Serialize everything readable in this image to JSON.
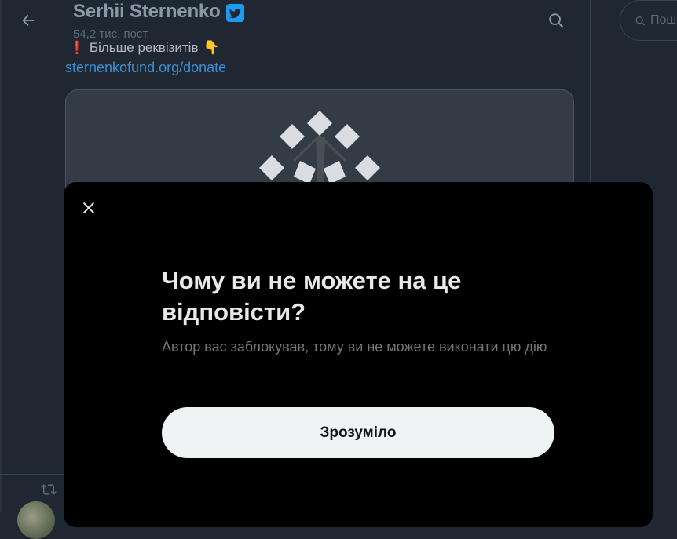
{
  "header": {
    "name": "Serhii Sternenko",
    "post_count": "54,2 тис. пост",
    "verified_icon": "verified-badge-icon",
    "back_icon": "arrow-left-icon",
    "search_icon": "search-icon"
  },
  "search": {
    "placeholder": "Пош"
  },
  "tweet": {
    "text_line": "Більше реквізитів",
    "link": "sternenkofund.org/donate"
  },
  "modal": {
    "title": "Чому ви не можете на це відповісти?",
    "description": "Автор вас заблокував, тому ви не можете виконати цю дію",
    "button_label": "Зрозуміло",
    "close_icon": "close-icon"
  },
  "colors": {
    "background": "#1f2732",
    "modal_bg": "#000000",
    "accent": "#1d9bf0",
    "link": "#3e8fd1",
    "button_bg": "#eff3f4"
  }
}
